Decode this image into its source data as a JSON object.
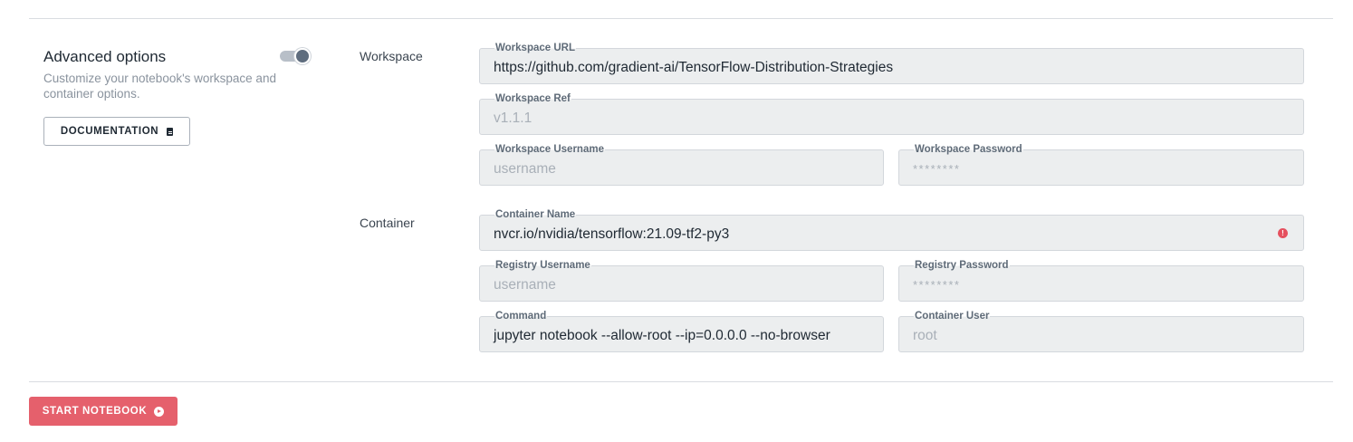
{
  "advanced": {
    "title": "Advanced options",
    "description": "Customize your notebook's workspace and container options.",
    "toggle_on": true,
    "documentation_label": "DOCUMENTATION"
  },
  "workspace": {
    "section_label": "Workspace",
    "url": {
      "label": "Workspace URL",
      "value": "https://github.com/gradient-ai/TensorFlow-Distribution-Strategies"
    },
    "ref": {
      "label": "Workspace Ref",
      "placeholder": "v1.1.1"
    },
    "username": {
      "label": "Workspace Username",
      "placeholder": "username"
    },
    "password": {
      "label": "Workspace Password",
      "placeholder": "********"
    }
  },
  "container": {
    "section_label": "Container",
    "name": {
      "label": "Container Name",
      "value": "nvcr.io/nvidia/tensorflow:21.09-tf2-py3",
      "error_icon": "!"
    },
    "registry_username": {
      "label": "Registry Username",
      "placeholder": "username"
    },
    "registry_password": {
      "label": "Registry Password",
      "placeholder": "********"
    },
    "command": {
      "label": "Command",
      "value": "jupyter notebook --allow-root --ip=0.0.0.0 --no-browser"
    },
    "user": {
      "label": "Container User",
      "placeholder": "root"
    }
  },
  "actions": {
    "start_label": "START NOTEBOOK"
  },
  "colors": {
    "accent": "#e5606c",
    "field_bg": "#eceeef"
  }
}
